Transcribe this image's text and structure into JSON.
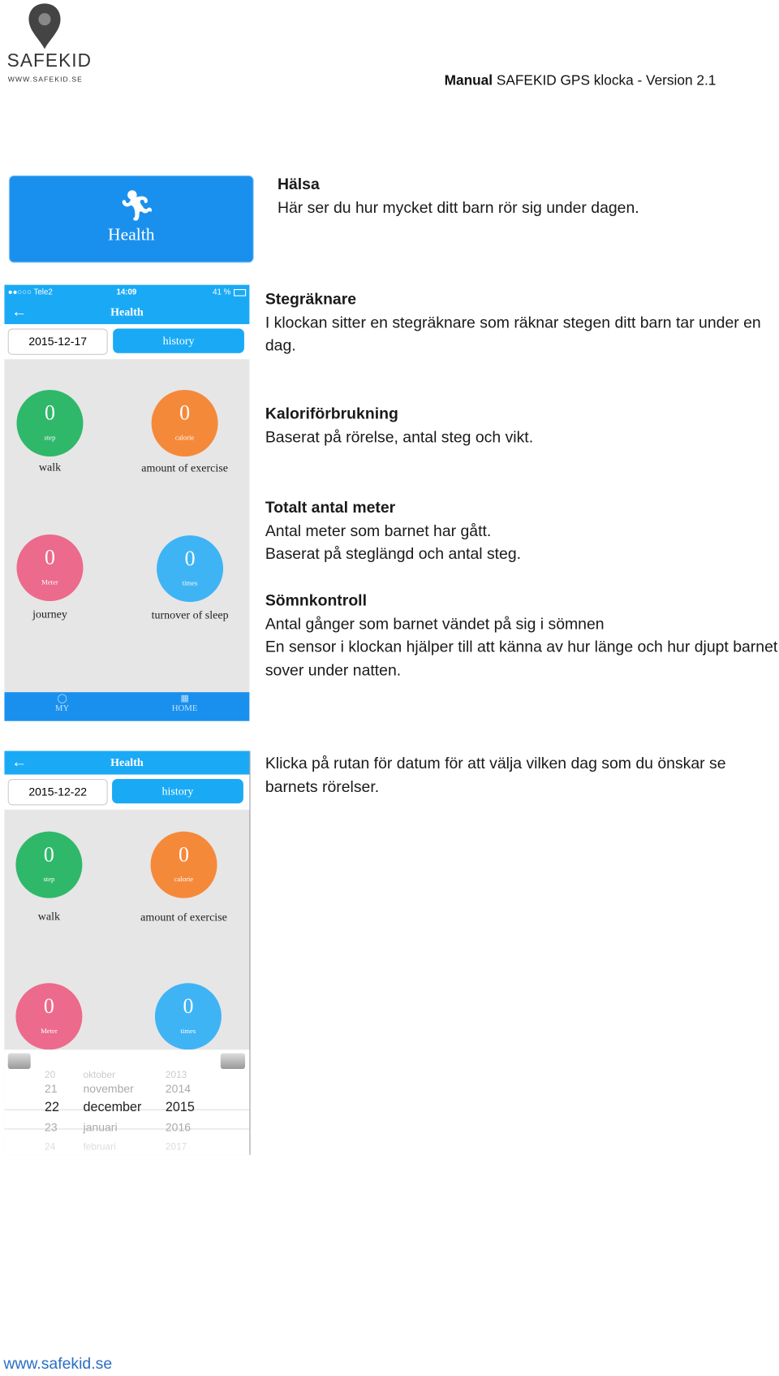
{
  "header": {
    "logo_text": "SAFEKID",
    "logo_url": "WWW.SAFEKID.SE",
    "title_bold": "Manual",
    "title_rest": " SAFEKID GPS klocka - Version 2.1"
  },
  "banner": {
    "label": "Health",
    "icon": "running-person-icon"
  },
  "sections": [
    {
      "title": "Hälsa",
      "body": "Här ser du hur mycket ditt barn rör sig under dagen."
    },
    {
      "title": "Stegräknare",
      "body": "I klockan sitter en stegräknare som räknar stegen ditt barn tar under en dag."
    },
    {
      "title": "Kaloriförbrukning",
      "body": "Baserat på rörelse, antal steg och vikt."
    },
    {
      "title": "Totalt antal meter",
      "body": "Antal meter som barnet har gått.",
      "body2": "Baserat på steglängd och antal steg."
    },
    {
      "title": "Sömnkontroll",
      "body": "Antal gånger som barnet vändet på sig i sömnen",
      "body2": "En sensor i klockan hjälper till att känna av hur länge och hur djupt barnet sover under natten."
    },
    {
      "title": "",
      "body": "Klicka på rutan för datum för att välja vilken dag som du önskar se barnets rörelser."
    }
  ],
  "phone1": {
    "status": {
      "carrier": "●●○○○ Tele2",
      "time": "14:09",
      "battery": "41 %"
    },
    "nav_title": "Health",
    "date": "2015-12-17",
    "history": "history",
    "metrics": [
      {
        "value": "0",
        "unit": "step",
        "label": "walk",
        "color": "#2fb86a"
      },
      {
        "value": "0",
        "unit": "calorie",
        "label": "amount of exercise",
        "color": "#f5893a"
      },
      {
        "value": "0",
        "unit": "Meter",
        "label": "journey",
        "color": "#ec6a8c"
      },
      {
        "value": "0",
        "unit": "times",
        "label": "turnover of sleep",
        "color": "#3fb4f5"
      }
    ],
    "tabs": [
      "MY",
      "HOME"
    ]
  },
  "phone2": {
    "nav_title": "Health",
    "date": "2015-12-22",
    "history": "history",
    "metrics": [
      {
        "value": "0",
        "unit": "step",
        "label": "walk"
      },
      {
        "value": "0",
        "unit": "calorie",
        "label": "amount of exercise"
      },
      {
        "value": "0",
        "unit": "Meter"
      },
      {
        "value": "0",
        "unit": "times"
      }
    ],
    "picker": {
      "days": [
        "20",
        "21",
        "22",
        "23",
        "24"
      ],
      "months": [
        "oktober",
        "november",
        "december",
        "januari",
        "februari"
      ],
      "years": [
        "2013",
        "2014",
        "2015",
        "2016",
        "2017"
      ]
    }
  },
  "footer": {
    "url": "www.safekid.se"
  }
}
